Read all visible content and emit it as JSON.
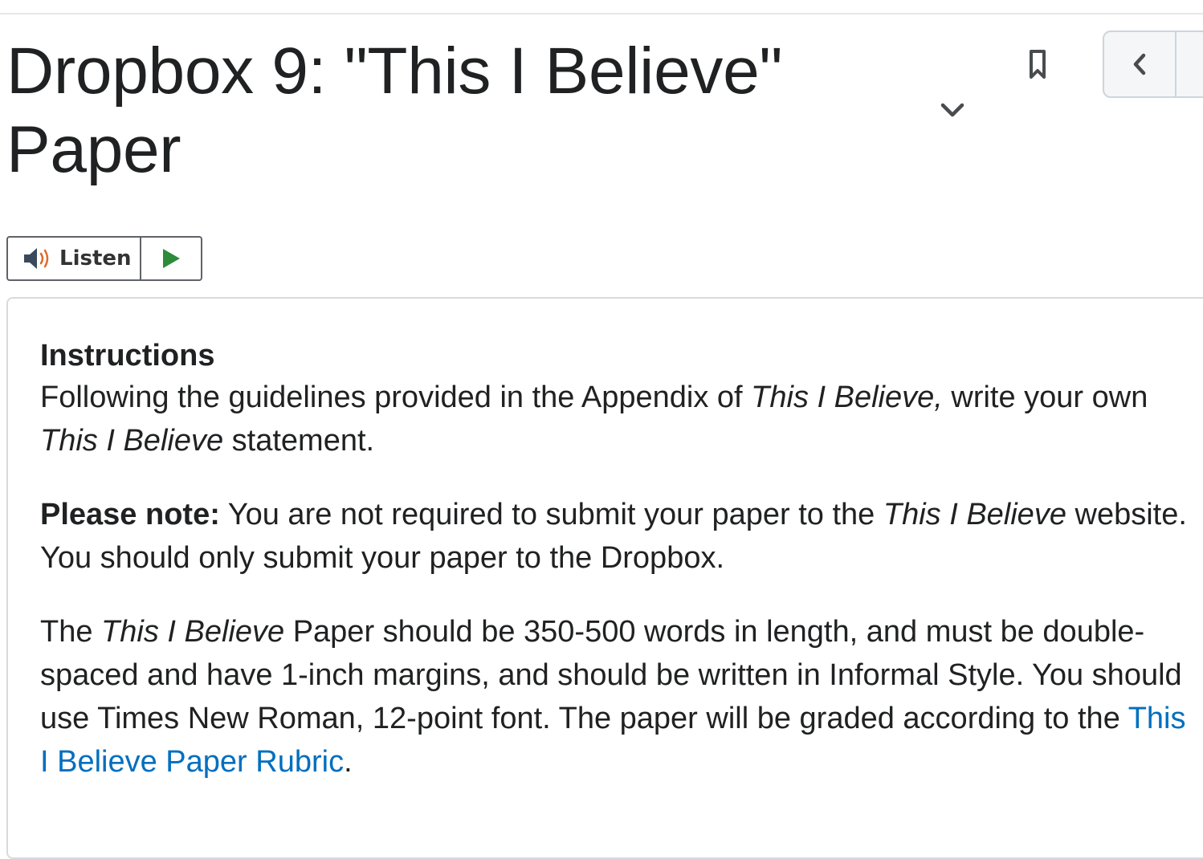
{
  "header": {
    "title": "Dropbox 9: \"This I Believe\" Paper"
  },
  "icons": {
    "options": "chevron-down-icon",
    "bookmark": "bookmark-icon",
    "previous": "chevron-left-icon",
    "speaker": "speaker-icon",
    "play": "play-icon"
  },
  "listen": {
    "label": "Listen"
  },
  "content": {
    "heading": "Instructions",
    "p1": {
      "a": "Following the guidelines provided in the Appendix of ",
      "b": "This I Believe,",
      "c": " write your own ",
      "d": "This I Believe",
      "e": " statement."
    },
    "p2": {
      "a": "Please note:",
      "b": " You are not required to submit your paper to the ",
      "c": "This I Believe",
      "d": " website. You should only submit your paper to the Dropbox."
    },
    "p3": {
      "a": "The ",
      "b": "This I Believe",
      "c": " Paper should be 350-500 words in length, and must be double-spaced and have 1-inch margins, and should be written in Informal Style. You should use Times New Roman, 12-point font. The paper will be graded according to the ",
      "link": "This I Believe Paper Rubric",
      "d": "."
    }
  },
  "colors": {
    "link": "#006fbf",
    "play": "#2e8b3a",
    "speaker_waves": "#e06a2b"
  }
}
